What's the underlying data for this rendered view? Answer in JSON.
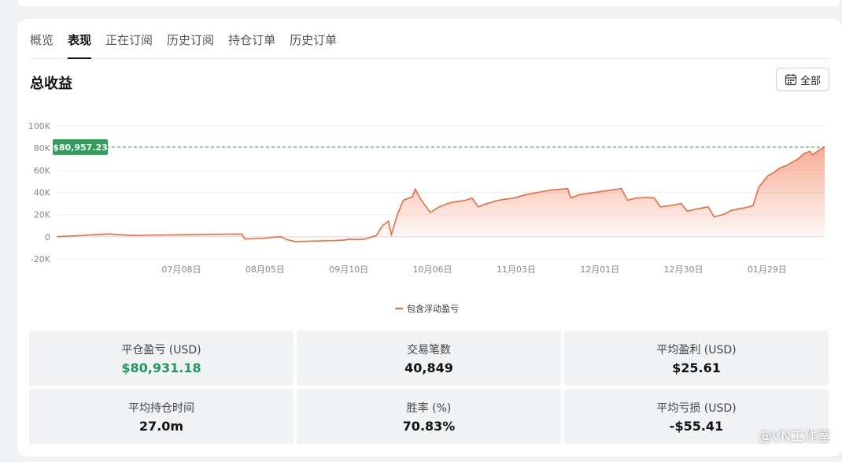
{
  "tabs": [
    "概览",
    "表现",
    "正在订阅",
    "历史订阅",
    "持仓订单",
    "历史订单"
  ],
  "active_tab": 1,
  "section_title": "总收益",
  "range_button": "全部",
  "chart_data": {
    "type": "area",
    "title": "",
    "xlabel": "",
    "ylabel": "",
    "ylim": [
      -20000,
      100000
    ],
    "y_ticks": [
      "100K",
      "80K",
      "60K",
      "40K",
      "20K",
      "0",
      "-20K"
    ],
    "x_ticks": [
      "07月08日",
      "08月05日",
      "09月10日",
      "10月06日",
      "11月03日",
      "12月01日",
      "12月30日",
      "01月29日"
    ],
    "reference_label": "$80,957.23",
    "reference_value": 80957.23,
    "grid": true,
    "series": [
      {
        "name": "包含浮动盈亏",
        "color": "#f06a3e",
        "points": [
          [
            0,
            0
          ],
          [
            3,
            500
          ],
          [
            6,
            800
          ],
          [
            9,
            1200
          ],
          [
            12,
            1800
          ],
          [
            15,
            2200
          ],
          [
            18,
            2500
          ],
          [
            20,
            2000
          ],
          [
            23,
            1500
          ],
          [
            26,
            1200
          ],
          [
            29,
            1300
          ],
          [
            32,
            1500
          ],
          [
            35,
            1500
          ],
          [
            38,
            1600
          ],
          [
            41,
            1800
          ],
          [
            44,
            1900
          ],
          [
            47,
            2000
          ],
          [
            50,
            2100
          ],
          [
            53,
            2200
          ],
          [
            56,
            2300
          ],
          [
            59,
            2300
          ],
          [
            62,
            2400
          ],
          [
            63,
            -2000
          ],
          [
            66,
            -1800
          ],
          [
            69,
            -1500
          ],
          [
            72,
            -500
          ],
          [
            75,
            0
          ],
          [
            77,
            -2500
          ],
          [
            80,
            -4500
          ],
          [
            84,
            -4000
          ],
          [
            88,
            -3800
          ],
          [
            92,
            -3500
          ],
          [
            96,
            -3000
          ],
          [
            98,
            -2200
          ],
          [
            100,
            -2500
          ],
          [
            103,
            -2200
          ],
          [
            105,
            -500
          ],
          [
            107,
            1000
          ],
          [
            109,
            10000
          ],
          [
            111,
            14000
          ],
          [
            112,
            2000
          ],
          [
            114,
            20000
          ],
          [
            116,
            33000
          ],
          [
            119,
            36000
          ],
          [
            120,
            43000
          ],
          [
            122,
            33000
          ],
          [
            125,
            22000
          ],
          [
            128,
            27000
          ],
          [
            132,
            31000
          ],
          [
            137,
            33000
          ],
          [
            139,
            35000
          ],
          [
            141,
            27000
          ],
          [
            144,
            30000
          ],
          [
            148,
            33000
          ],
          [
            153,
            35000
          ],
          [
            157,
            38000
          ],
          [
            161,
            40000
          ],
          [
            165,
            42000
          ],
          [
            169,
            43000
          ],
          [
            171,
            43500
          ],
          [
            172,
            35000
          ],
          [
            175,
            38000
          ],
          [
            180,
            40000
          ],
          [
            185,
            42000
          ],
          [
            189,
            43500
          ],
          [
            191,
            33000
          ],
          [
            194,
            35000
          ],
          [
            198,
            35500
          ],
          [
            200,
            35000
          ],
          [
            202,
            27000
          ],
          [
            205,
            28000
          ],
          [
            209,
            30000
          ],
          [
            211,
            23000
          ],
          [
            214,
            25000
          ],
          [
            218,
            27000
          ],
          [
            220,
            18000
          ],
          [
            223,
            20000
          ],
          [
            226,
            24000
          ],
          [
            230,
            26000
          ],
          [
            233,
            28000
          ],
          [
            235,
            45000
          ],
          [
            238,
            55000
          ],
          [
            240,
            58000
          ],
          [
            242,
            62000
          ],
          [
            244,
            64000
          ],
          [
            246,
            67000
          ],
          [
            248,
            70000
          ],
          [
            250,
            75000
          ],
          [
            252,
            77000
          ],
          [
            253,
            74000
          ],
          [
            255,
            78000
          ],
          [
            257,
            81000
          ]
        ]
      }
    ]
  },
  "stats": [
    {
      "label": "平仓盈亏 (USD)",
      "value": "$80,931.18",
      "positive": true
    },
    {
      "label": "交易笔数",
      "value": "40,849",
      "positive": false
    },
    {
      "label": "平均盈利 (USD)",
      "value": "$25.61",
      "positive": false
    },
    {
      "label": "平均持仓时间",
      "value": "27.0m",
      "positive": false
    },
    {
      "label": "胜率 (%)",
      "value": "70.83%",
      "positive": false
    },
    {
      "label": "平均亏损 (USD)",
      "value": "-$55.41",
      "positive": false
    }
  ],
  "watermark": "@VN工作室"
}
